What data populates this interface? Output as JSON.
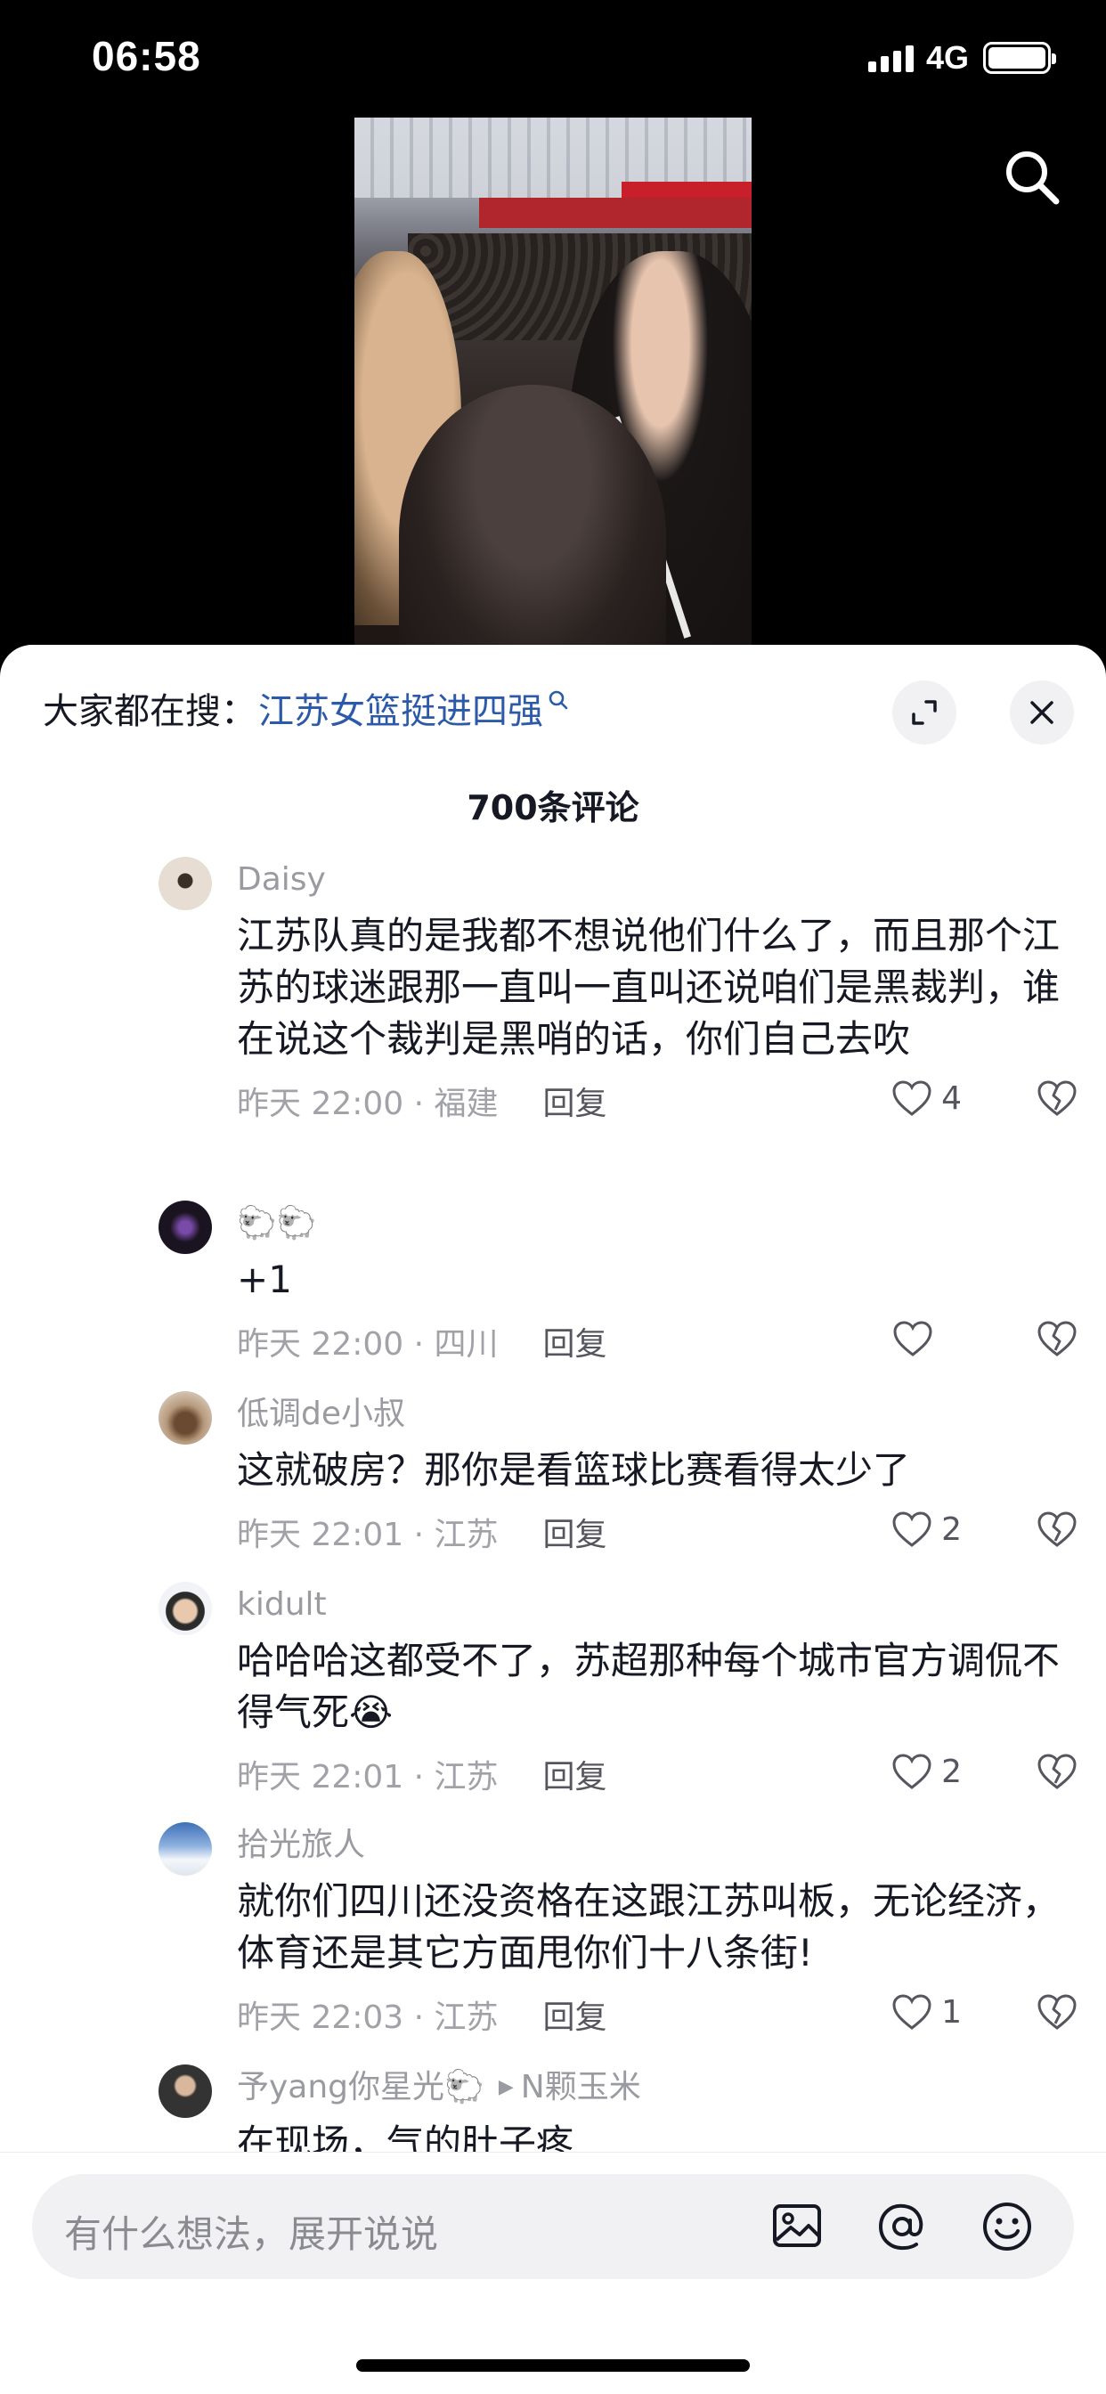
{
  "status": {
    "time": "06:58",
    "network": "4G"
  },
  "hot_search": {
    "prefix": "大家都在搜：",
    "term": "江苏女篮挺进四强"
  },
  "comment_count": "700条评论",
  "comments": [
    {
      "user": "Daisy",
      "text": "江苏队真的是我都不想说他们什么了，而且那个江苏的球迷跟那一直叫一直叫还说咱们是黑裁判，谁在说这个裁判是黑哨的话，你们自己去吹",
      "meta": "昨天 22:00 · 福建",
      "reply": "回复",
      "likes": "4"
    },
    {
      "user": "🐑🐑",
      "text": "+1",
      "meta": "昨天 22:00 · 四川",
      "reply": "回复",
      "likes": ""
    },
    {
      "user": "低调de小叔",
      "text": "这就破房？那你是看篮球比赛看得太少了",
      "meta": "昨天 22:01 · 江苏",
      "reply": "回复",
      "likes": "2"
    },
    {
      "user": "kidult",
      "text": "哈哈哈这都受不了，苏超那种每个城市官方调侃不得气死😭",
      "meta": "昨天 22:01 · 江苏",
      "reply": "回复",
      "likes": "2"
    },
    {
      "user": "拾光旅人",
      "text": "就你们四川还没资格在这跟江苏叫板，无论经济，体育还是其它方面甩你们十八条街!",
      "meta": "昨天 22:03 · 江苏",
      "reply": "回复",
      "likes": "1"
    },
    {
      "user": "予yang你星光🐑",
      "reply_to": "N颗玉米",
      "text": "在现场，气的肚子疼"
    }
  ],
  "input": {
    "placeholder": "有什么想法，展开说说"
  },
  "colors": {
    "accent_link": "#2d5aa8",
    "sheet_bg": "#ffffff",
    "muted": "#9a9ba1"
  }
}
